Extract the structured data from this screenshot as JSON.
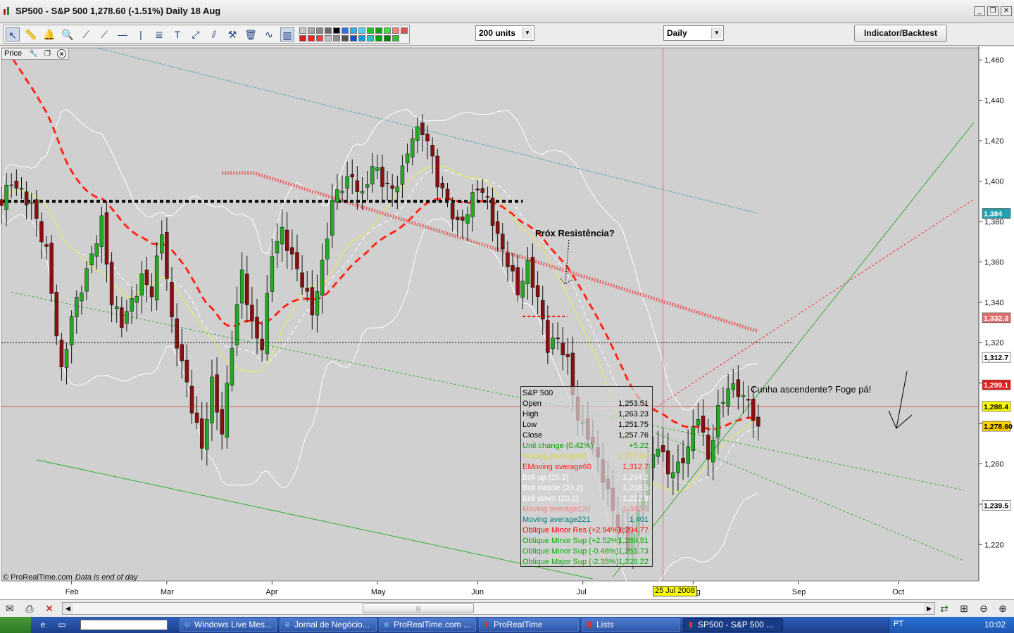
{
  "window": {
    "title": "SP500 - S&P 500    1,278.60 (-1.51%)    Daily  18 Aug",
    "buttons": {
      "minimize": "_",
      "restore": "❐",
      "close": "✕"
    }
  },
  "toolbar": {
    "units_select": "200 units",
    "period_select": "Daily",
    "indicator_button": "Indicator/Backtest",
    "tool_icons": [
      "cursor-icon",
      "ruler-icon",
      "alarm-icon",
      "zoom-icon",
      "line-tool-icon",
      "ray-tool-icon",
      "horizontal-line-icon",
      "vertical-line-icon",
      "fibonacci-icon",
      "text-tool-icon",
      "channel-icon",
      "fan-icon",
      "properties-icon",
      "trash-icon",
      "chart-type-icon",
      "candlestick-icon"
    ],
    "palette": [
      "#c8c8c8",
      "#a8a8a8",
      "#888888",
      "#686868",
      "#000000",
      "#3070f0",
      "#30b0f0",
      "#50d0ff",
      "#20c020",
      "#10a010",
      "#40e040",
      "#f08080",
      "#e05050",
      "#d02020",
      "#ff2020",
      "#f04040",
      "#c0c0c0",
      "#909090",
      "#505050",
      "#1050d0",
      "#00a0e0",
      "#30c0c0",
      "#00a000",
      "#008000",
      "#30c030"
    ]
  },
  "chart_pane": {
    "label": "Price",
    "copyright": "© ProRealTime.com",
    "copyright_note": "Data is end of day",
    "annotation_resistance": "Próx Resistência?",
    "annotation_wedge": "Cunha ascendente? Foge pá!",
    "date_flag": "25 Jul 2008"
  },
  "chart_data": {
    "type": "candlestick",
    "title": "SP500 - S&P 500",
    "y_ticks": [
      1460,
      1440,
      1420,
      1400,
      1380,
      1360,
      1340,
      1320,
      1300,
      1280,
      1260,
      1240,
      1220
    ],
    "y_tick_labels": [
      "1,460",
      "1,440",
      "1,420",
      "1,400",
      "1,380",
      "1,360",
      "1,340",
      "1,320",
      "1,300",
      "1,280",
      "1,260",
      "1,240",
      "1,220"
    ],
    "y_range": [
      1202,
      1466
    ],
    "x_labels": [
      {
        "label": "Feb",
        "day": 0
      },
      {
        "label": "Mar",
        "day": 19
      },
      {
        "label": "Apr",
        "day": 40
      },
      {
        "label": "May",
        "day": 61
      },
      {
        "label": "Jun",
        "day": 81
      },
      {
        "label": "Jul",
        "day": 102
      },
      {
        "label": "Aug",
        "day": 124
      },
      {
        "label": "Sep",
        "day": 145
      },
      {
        "label": "Oct",
        "day": 165
      }
    ],
    "x_day_range": [
      -14,
      181
    ],
    "last_day": 137,
    "crosshair": {
      "date": "25 Jul 2008",
      "day": 118,
      "price": 1288.4
    },
    "price_flags": [
      {
        "label": "1,384",
        "value": 1384,
        "color": "#20a0b0"
      },
      {
        "label": "1,332.3",
        "value": 1332.3,
        "color": "#e07070"
      },
      {
        "label": "1,312.7",
        "value": 1312.7,
        "color": "#ffffff"
      },
      {
        "label": "1,299.1",
        "value": 1299.1,
        "color": "#e02020"
      },
      {
        "label": "1,288.4",
        "value": 1288.4,
        "color": "#ffff00"
      },
      {
        "label": "1,278.60",
        "value": 1278.6,
        "color": "#ffd000"
      },
      {
        "label": "1,239.5",
        "value": 1239.5,
        "color": "#ffffff"
      }
    ],
    "horizontal_levels": [
      {
        "value": 1390,
        "color": "#000000",
        "style": "heavy-dotted"
      },
      {
        "value": 1320,
        "color": "#000000",
        "style": "dotted"
      },
      {
        "value": 1333,
        "color": "#ff0000",
        "style": "dashed-short",
        "from_day": 90,
        "to_day": 99
      }
    ],
    "trend_lines": [
      {
        "name": "major-channel-bottom",
        "color": "#30b030",
        "style": "solid",
        "p1": [
          -7,
          1262
        ],
        "p2": [
          104,
          1203
        ]
      },
      {
        "name": "green-channel-upper",
        "color": "#30b030",
        "style": "dotted",
        "p1": [
          -12,
          1345
        ],
        "p2": [
          178,
          1247
        ]
      },
      {
        "name": "green-channel-lower",
        "color": "#30b030",
        "style": "dotted",
        "p1": [
          108,
          1284
        ],
        "p2": [
          178,
          1212
        ]
      },
      {
        "name": "wedge-support",
        "color": "#30b030",
        "style": "solid",
        "p1": [
          108,
          1204
        ],
        "p2": [
          180,
          1429
        ]
      },
      {
        "name": "wedge-resistance",
        "color": "#ff2020",
        "style": "dotted",
        "p1": [
          116,
          1287
        ],
        "p2": [
          180,
          1391
        ]
      }
    ],
    "indicators": [
      {
        "name": "Moving average20",
        "color": "#e8e860",
        "value": "1,270.82"
      },
      {
        "name": "EMoving average60",
        "color": "#ff2020",
        "value": "1,312.7"
      },
      {
        "name": "Boll up (20,2)",
        "color": "#ffffff",
        "value": "1,294.2"
      },
      {
        "name": "Boll middle (20,2)",
        "color": "#ffffff",
        "value": "1,258.5"
      },
      {
        "name": "Boll down (20,2)",
        "color": "#ffffff",
        "value": "1,222.8"
      },
      {
        "name": "Moving average120",
        "color": "#e07070",
        "value": "1,342.1"
      },
      {
        "name": "Moving average221",
        "color": "#20a0b0",
        "value": "1,401"
      }
    ],
    "anchors": [
      [
        -14,
        1390
      ],
      [
        -12,
        1400
      ],
      [
        -8,
        1388
      ],
      [
        -5,
        1365
      ],
      [
        -2,
        1305
      ],
      [
        0,
        1333
      ],
      [
        3,
        1355
      ],
      [
        6,
        1380
      ],
      [
        8,
        1340
      ],
      [
        10,
        1330
      ],
      [
        12,
        1340
      ],
      [
        14,
        1352
      ],
      [
        16,
        1345
      ],
      [
        18,
        1375
      ],
      [
        20,
        1330
      ],
      [
        22,
        1310
      ],
      [
        24,
        1288
      ],
      [
        26,
        1268
      ],
      [
        28,
        1300
      ],
      [
        30,
        1275
      ],
      [
        32,
        1320
      ],
      [
        34,
        1355
      ],
      [
        36,
        1328
      ],
      [
        38,
        1318
      ],
      [
        40,
        1365
      ],
      [
        42,
        1375
      ],
      [
        44,
        1362
      ],
      [
        46,
        1350
      ],
      [
        48,
        1335
      ],
      [
        50,
        1358
      ],
      [
        52,
        1390
      ],
      [
        54,
        1398
      ],
      [
        56,
        1402
      ],
      [
        58,
        1392
      ],
      [
        60,
        1408
      ],
      [
        62,
        1400
      ],
      [
        64,
        1395
      ],
      [
        66,
        1405
      ],
      [
        68,
        1423
      ],
      [
        70,
        1425
      ],
      [
        71,
        1420
      ],
      [
        73,
        1400
      ],
      [
        75,
        1390
      ],
      [
        77,
        1378
      ],
      [
        79,
        1385
      ],
      [
        81,
        1398
      ],
      [
        83,
        1390
      ],
      [
        85,
        1372
      ],
      [
        87,
        1360
      ],
      [
        89,
        1345
      ],
      [
        91,
        1358
      ],
      [
        93,
        1342
      ],
      [
        95,
        1318
      ],
      [
        97,
        1322
      ],
      [
        99,
        1310
      ],
      [
        101,
        1282
      ],
      [
        103,
        1275
      ],
      [
        105,
        1262
      ],
      [
        107,
        1245
      ],
      [
        109,
        1230
      ],
      [
        111,
        1218
      ],
      [
        113,
        1234
      ],
      [
        115,
        1258
      ],
      [
        117,
        1270
      ],
      [
        119,
        1256
      ],
      [
        121,
        1258
      ],
      [
        123,
        1268
      ],
      [
        125,
        1285
      ],
      [
        127,
        1262
      ],
      [
        129,
        1286
      ],
      [
        131,
        1298
      ],
      [
        133,
        1296
      ],
      [
        135,
        1290
      ],
      [
        137,
        1278.6
      ]
    ]
  },
  "data_window": {
    "title": "S&P 500",
    "rows": [
      {
        "label": "Open",
        "value": "1,253.51",
        "color": "#000000"
      },
      {
        "label": "High",
        "value": "1,263.23",
        "color": "#000000"
      },
      {
        "label": "Low",
        "value": "1,251.75",
        "color": "#000000"
      },
      {
        "label": "Close",
        "value": "1,257.76",
        "color": "#000000"
      },
      {
        "label": "Unit change (0.42%)",
        "value": "+5.22",
        "color": "#00a000"
      },
      {
        "label": "Moving average20",
        "value": "1,270.82",
        "color": "#d8d840"
      },
      {
        "label": "EMoving average60",
        "value": "1,312.7",
        "color": "#ff2020"
      },
      {
        "label": "Boll up (20,2)",
        "value": "1,294.2",
        "color": "#ffffff"
      },
      {
        "label": "Boll middle (20,2)",
        "value": "1,258.5",
        "color": "#ffffff"
      },
      {
        "label": "Boll down (20,2)",
        "value": "1,222.8",
        "color": "#ffffff"
      },
      {
        "label": "Moving average120",
        "value": "1,342.1",
        "color": "#f08080"
      },
      {
        "label": "Moving average221",
        "value": "1,401",
        "color": "#008080"
      },
      {
        "label": "Oblique Minor Res (+2.94%)",
        "value": "1,294.77",
        "color": "#ff0000"
      },
      {
        "label": "Oblique Minor Sup (+2.52%)",
        "value": "1,289.51",
        "color": "#00b000"
      },
      {
        "label": "Oblique Minor Sup (-0.48%)",
        "value": "1,251.73",
        "color": "#00b000"
      },
      {
        "label": "Oblique Major Sup (-2.35%)",
        "value": "1,228.22",
        "color": "#00b000"
      }
    ]
  },
  "taskbar": {
    "items": [
      {
        "label": "Windows Live Mes...",
        "icon": "messenger-icon"
      },
      {
        "label": "Jornal de Negócio...",
        "icon": "browser-icon"
      },
      {
        "label": "ProRealTime.com ...",
        "icon": "browser-icon"
      },
      {
        "label": "ProRealTime",
        "icon": "app-icon"
      },
      {
        "label": "Lists",
        "icon": "app-icon"
      },
      {
        "label": "SP500 - S&P 500 ...",
        "icon": "chart-icon"
      }
    ],
    "language": "PT",
    "clock": "10:02"
  }
}
